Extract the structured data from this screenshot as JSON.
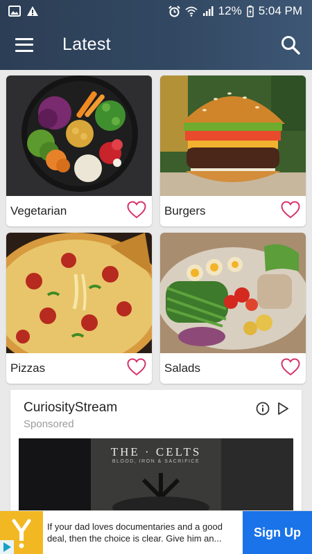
{
  "status_bar": {
    "icons_left": [
      "image-icon",
      "warning-icon"
    ],
    "icons_right": [
      "alarm-icon",
      "wifi-icon",
      "signal-icon",
      "battery-icon"
    ],
    "battery": "12%",
    "time": "5:04 PM"
  },
  "app_bar": {
    "title": "Latest",
    "menu_icon": "hamburger-menu-icon",
    "search_icon": "search-icon"
  },
  "categories": [
    {
      "label": "Vegetarian",
      "icon": "heart-outline-icon"
    },
    {
      "label": "Burgers",
      "icon": "heart-outline-icon"
    },
    {
      "label": "Pizzas",
      "icon": "heart-outline-icon"
    },
    {
      "label": "Salads",
      "icon": "heart-outline-icon"
    }
  ],
  "ad": {
    "advertiser": "CuriosityStream",
    "sponsored_label": "Sponsored",
    "video_title": "THE · CELTS",
    "video_subtitle": "BLOOD, IRON & SACRIFICE"
  },
  "banner": {
    "text": "If your dad loves documentaries and a good deal, then the choice is clear. Give him an...",
    "button": "Sign Up"
  },
  "colors": {
    "accent_heart": "#d6336c",
    "topbar": "#324862",
    "banner_button": "#1a73e8",
    "banner_logo": "#f2b824"
  }
}
